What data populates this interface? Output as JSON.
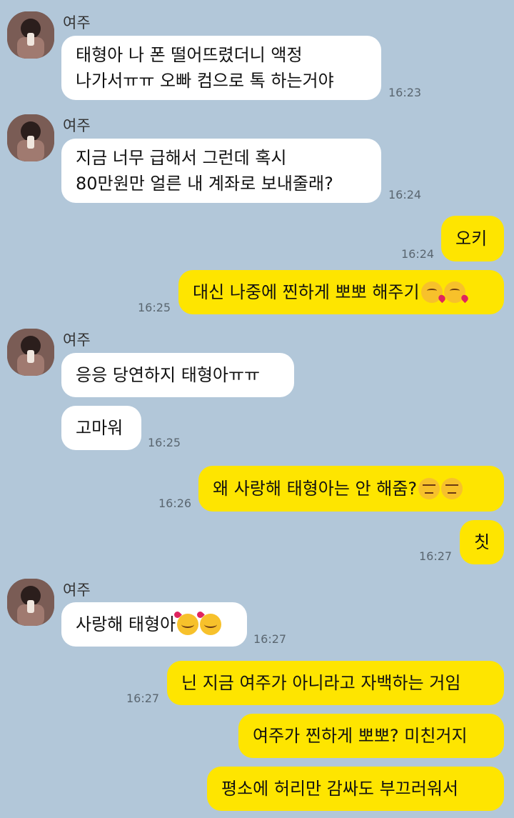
{
  "contact": {
    "name": "여주"
  },
  "messages": [
    {
      "from": "in",
      "lines": [
        "태형아 나 폰 떨어뜨렸더니 액정",
        "나가서ㅠㅠ 오빠 컴으로 톡 하는거야"
      ],
      "time": "16:23"
    },
    {
      "from": "in",
      "lines": [
        "지금 너무 급해서 그런데 혹시",
        "80만원만 얼른 내 계좌로 보내줄래?"
      ],
      "time": "16:24"
    },
    {
      "from": "out",
      "text": "오키",
      "time": "16:24"
    },
    {
      "from": "out",
      "text": "대신 나중에 찐하게 뽀뽀 해주기",
      "emoji": "kissing-wink-emoji",
      "time": "16:25"
    },
    {
      "from": "in",
      "text": "응응 당연하지 태형아ㅠㅠ"
    },
    {
      "from": "in",
      "text": "고마워",
      "time": "16:25"
    },
    {
      "from": "out",
      "text": "왜 사랑해 태형아는 안 해줌?",
      "emoji": "expressionless-emoji",
      "time": "16:26"
    },
    {
      "from": "out",
      "text": "칫",
      "time": "16:27"
    },
    {
      "from": "in",
      "text": "사랑해 태형아",
      "emoji": "smiling-hearts-emoji",
      "time": "16:27"
    },
    {
      "from": "out",
      "text": "닌 지금 여주가 아니라고 자백하는 거임",
      "time": "16:27"
    },
    {
      "from": "out",
      "text": "여주가 찐하게 뽀뽀? 미친거지"
    },
    {
      "from": "out",
      "text": "평소에 허리만 감싸도 부끄러워서"
    }
  ],
  "colors": {
    "background": "#b2c7d9",
    "incoming_bubble": "#ffffff",
    "outgoing_bubble": "#fee500"
  }
}
